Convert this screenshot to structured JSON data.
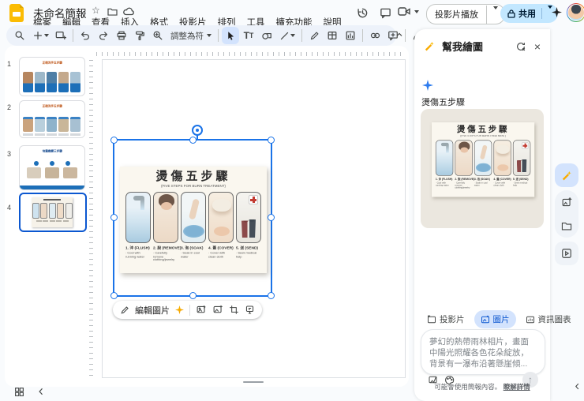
{
  "colors": {
    "accent": "#0b57d0",
    "share_button_bg": "#c2e7ff",
    "toolbar_bg": "#edf2fa",
    "selected_chip_bg": "#d3e3fd",
    "panel_image_card_bg": "#ebe7df",
    "selection_blue": "#1a73e8"
  },
  "header": {
    "doc_title": "未命名簡報",
    "menus": [
      "檔案",
      "編輯",
      "查看",
      "插入",
      "格式",
      "投影片",
      "排列",
      "工具",
      "擴充功能",
      "說明"
    ],
    "slideshow_label": "投影片播放",
    "share_label": "共用"
  },
  "toolbar": {
    "fit_label": "調整為符",
    "textbox_glyph": "T",
    "more_glyph": "⋮"
  },
  "filmstrip": {
    "slides": [
      {
        "num": "1",
        "title": "正確洗手五步驟"
      },
      {
        "num": "2",
        "title": "正確洗手五步驟"
      },
      {
        "num": "3",
        "title": "地震應變三步驟"
      },
      {
        "num": "4",
        "title": ""
      }
    ]
  },
  "poster": {
    "title": "燙傷五步驟",
    "subtitle": "(FIVE STEPS FOR BURN TREATMENT)",
    "steps": [
      {
        "label": "1. 沖 (FLUSH)",
        "desc": "· Cool with running water"
      },
      {
        "label": "2. 脫 (REMOVE)",
        "desc": "· Carefully remove clothing/jewelry"
      },
      {
        "label": "3. 泡 (SOAK)",
        "desc": "· Soak in cool water"
      },
      {
        "label": "4. 蓋 (COVER)",
        "desc": "· Cover with clean cloth"
      },
      {
        "label": "5. 送 (SEND)",
        "desc": "· Seek medical help"
      }
    ]
  },
  "image_toolbar": {
    "edit_label": "編輯圖片"
  },
  "side_panel": {
    "title": "幫我繪圖",
    "prompt": "燙傷五步驟",
    "tabs": [
      {
        "label": "投影片"
      },
      {
        "label": "圖片"
      },
      {
        "label": "資訊圖表"
      }
    ],
    "input_text": "夢幻的熱帶雨林相片，畫面中陽光照耀各色花朵綻放，背景有一瀑布沿著懸崖傾...",
    "disclaimer": "可能會使用簡報內容。",
    "learn_more_label": "瞭解詳情"
  }
}
